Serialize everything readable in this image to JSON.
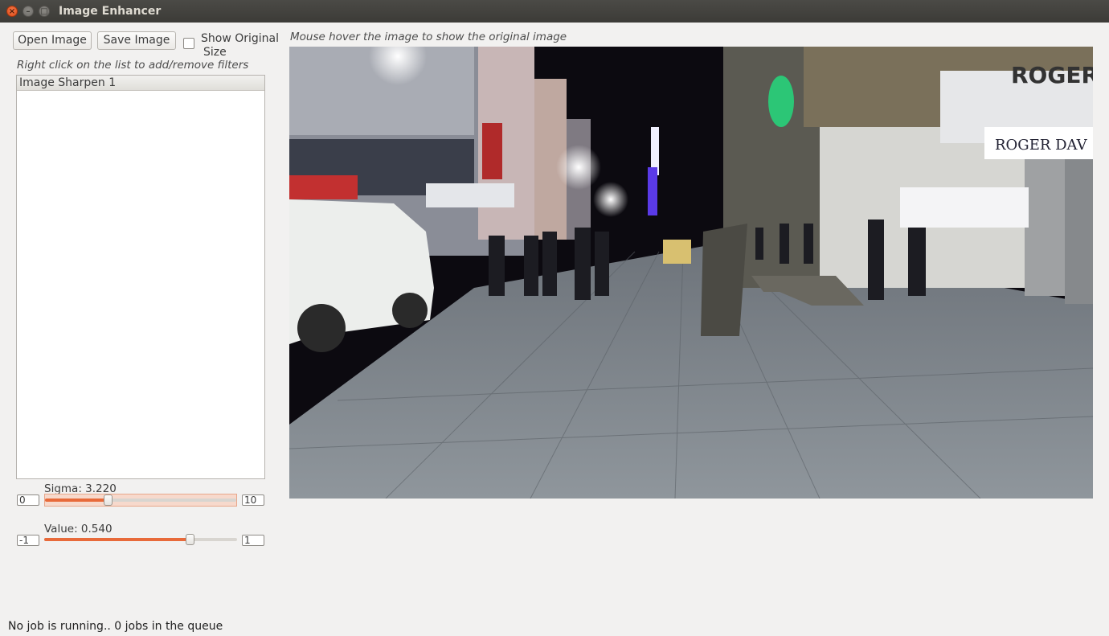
{
  "window": {
    "title": "Image Enhancer"
  },
  "toolbar": {
    "open_label": "Open Image",
    "save_label": "Save Image",
    "show_original_label_line1": "Show Original",
    "show_original_label_line2": "Size",
    "show_original_checked": false
  },
  "hints": {
    "list_hint": "Right click on the list to add/remove filters",
    "image_hint": "Mouse hover the image to show the original image"
  },
  "filters": {
    "items": [
      {
        "label": "Image Sharpen 1"
      }
    ]
  },
  "params": {
    "sigma": {
      "label": "Sigma: 3.220",
      "min": "0",
      "max": "10",
      "value": 3.22,
      "min_value": 0,
      "max_value": 10
    },
    "value": {
      "label": "Value: 0.540",
      "min": "-1",
      "max": "1",
      "value": 0.54,
      "min_value": -1,
      "max_value": 1
    }
  },
  "colors": {
    "accent": "#e86a3a",
    "close_button": "#df4a16"
  },
  "status": {
    "text": "No job is running.. 0 jobs in the queue"
  }
}
